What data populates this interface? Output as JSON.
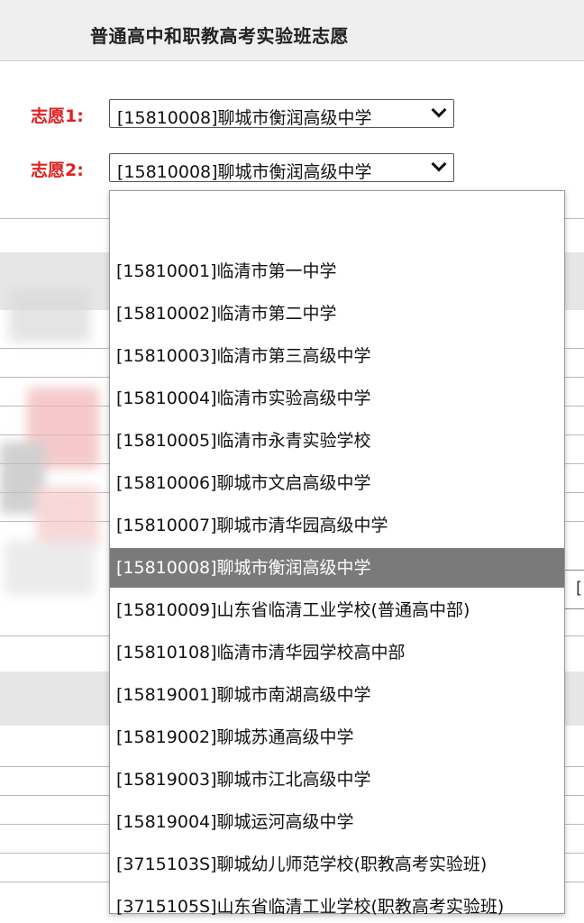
{
  "header": {
    "title": "普通高中和职教高考实验班志愿"
  },
  "choices": [
    {
      "label": "志愿1:",
      "value": "[15810008]聊城市衡润高级中学"
    },
    {
      "label": "志愿2:",
      "value": "[15810008]聊城市衡润高级中学"
    }
  ],
  "dropdown": {
    "selected_index": 8,
    "options": [
      "",
      "[15810001]临清市第一中学",
      "[15810002]临清市第二中学",
      "[15810003]临清市第三高级中学",
      "[15810004]临清市实验高级中学",
      "[15810005]临清市永青实验学校",
      "[15810006]聊城市文启高级中学",
      "[15810007]聊城市清华园高级中学",
      "[15810008]聊城市衡润高级中学",
      "[15810009]山东省临清工业学校(普通高中部)",
      "[15810108]临清市清华园学校高中部",
      "[15819001]聊城市南湖高级中学",
      "[15819002]聊城苏通高级中学",
      "[15819003]聊城市江北高级中学",
      "[15819004]聊城运河高级中学",
      "[3715103S]聊城幼儿师范学校(职教高考实验班)",
      "[3715105S]山东省临清工业学校(职教高考实验班)"
    ]
  },
  "side_box": {
    "text": "["
  }
}
